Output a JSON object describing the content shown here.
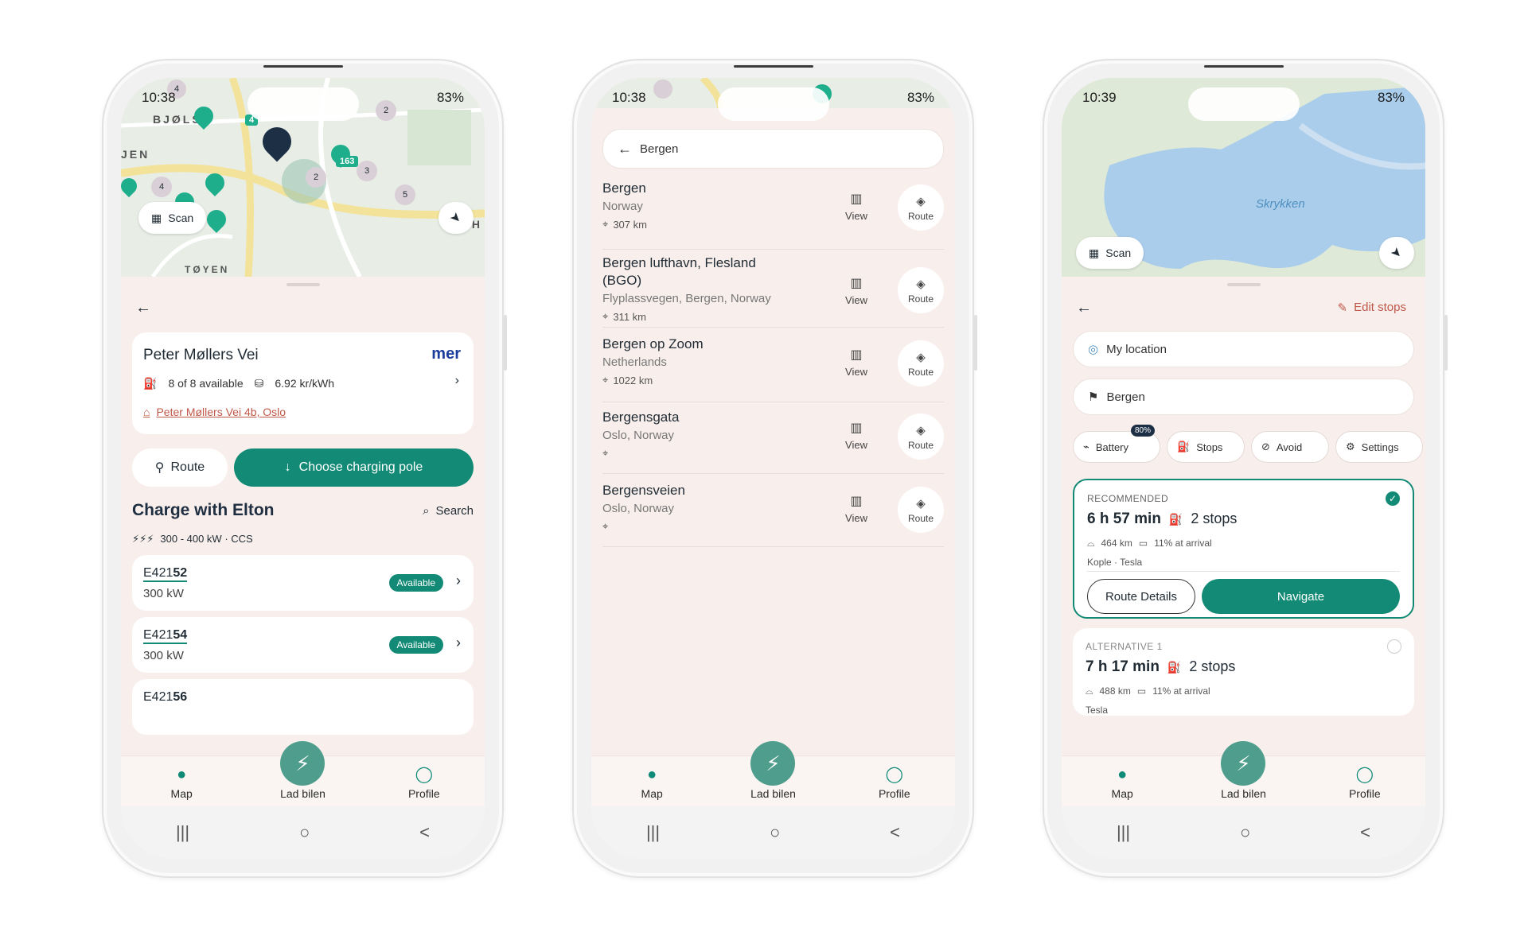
{
  "colors": {
    "accent": "#138a75",
    "sheet_bg": "#f8efec",
    "link": "#c0584a"
  },
  "phone1": {
    "status": {
      "time": "10:38",
      "battery": "83%"
    },
    "map_labels": {
      "area1": "BJØLS",
      "area2": "JEN",
      "area3": "TØYEN",
      "edge": "H"
    },
    "map_markers": [
      "4",
      "2",
      "4",
      "163",
      "3",
      "2",
      "4",
      "5"
    ],
    "scan_label": "Scan",
    "station": {
      "name": "Peter Møllers Vei",
      "brand": "mer",
      "availability": "8 of 8 available",
      "price": "6.92 kr/kWh",
      "address": "Peter Møllers Vei 4b, Oslo"
    },
    "route_label": "Route",
    "choose_label": "Choose charging pole",
    "section_title": "Charge with Elton",
    "search_label": "Search",
    "power_spec": "300 - 400 kW · CCS",
    "poles": [
      {
        "id_prefix": "E421",
        "id_bold": "52",
        "power": "300 kW",
        "status": "Available"
      },
      {
        "id_prefix": "E421",
        "id_bold": "54",
        "power": "300 kW",
        "status": "Available"
      },
      {
        "id_prefix": "E421",
        "id_bold": "56",
        "power": "",
        "status": ""
      }
    ]
  },
  "phone2": {
    "status": {
      "time": "10:38",
      "battery": "83%"
    },
    "search_value": "Bergen",
    "view_label": "View",
    "route_label": "Route",
    "results": [
      {
        "title": "Bergen",
        "sub": "Norway",
        "dist": "307 km"
      },
      {
        "title": "Bergen lufthavn, Flesland (BGO)",
        "sub": "Flyplassvegen, Bergen, Norway",
        "dist": "311 km"
      },
      {
        "title": "Bergen op Zoom",
        "sub": "Netherlands",
        "dist": "1022 km"
      },
      {
        "title": "Bergensgata",
        "sub": "Oslo, Norway",
        "dist": ""
      },
      {
        "title": "Bergensveien",
        "sub": "Oslo, Norway",
        "dist": ""
      }
    ]
  },
  "phone3": {
    "status": {
      "time": "10:39",
      "battery": "83%"
    },
    "map_label": "Skrykken",
    "scan_label": "Scan",
    "edit_stops": "Edit stops",
    "from": "My location",
    "to": "Bergen",
    "options": {
      "battery": "Battery",
      "battery_badge": "80%",
      "stops": "Stops",
      "avoid": "Avoid",
      "settings": "Settings"
    },
    "recommended": {
      "tag": "RECOMMENDED",
      "duration": "6 h 57 min",
      "stops": "2 stops",
      "distance": "464 km",
      "arrival": "11% at arrival",
      "via": "Kople · Tesla",
      "details_label": "Route Details",
      "navigate_label": "Navigate"
    },
    "alternative": {
      "tag": "ALTERNATIVE 1",
      "duration": "7 h 17 min",
      "stops": "2 stops",
      "distance": "488 km",
      "arrival": "11% at arrival",
      "via": "Tesla"
    }
  },
  "nav": {
    "map": "Map",
    "lad": "Lad bilen",
    "profile": "Profile"
  },
  "sys": {
    "recents": "|||",
    "home": "○",
    "back": "<"
  }
}
